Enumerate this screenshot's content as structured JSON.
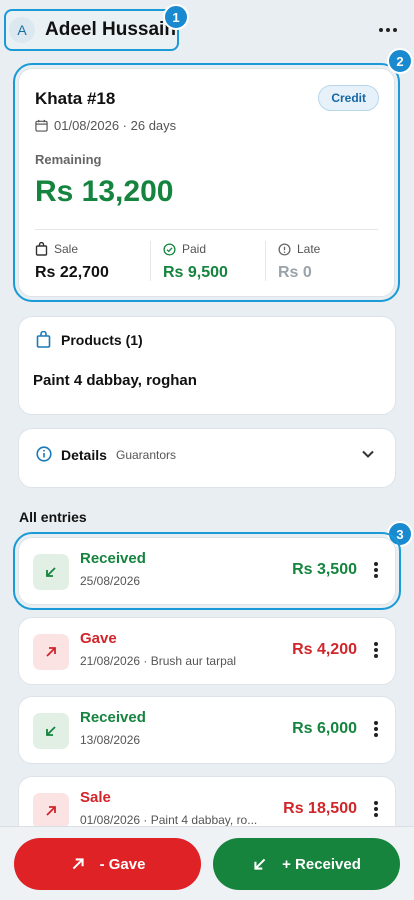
{
  "header": {
    "avatar_initial": "A",
    "user_name": "Adeel Hussain",
    "badge_1": "1"
  },
  "khata": {
    "title": "Khata #18",
    "credit_label": "Credit",
    "date_text": "01/08/2026 · 26 days",
    "remaining_label": "Remaining",
    "remaining_amount": "Rs 13,200",
    "badge_2": "2",
    "stats": [
      {
        "label": "Sale",
        "value": "Rs 22,700"
      },
      {
        "label": "Paid",
        "value": "Rs 9,500"
      },
      {
        "label": "Late",
        "value": "Rs 0"
      }
    ]
  },
  "products": {
    "title": "Products (1)",
    "text": "Paint 4 dabbay, roghan"
  },
  "details": {
    "title": "Details",
    "subtitle": "Guarantors"
  },
  "entries_section": {
    "title": "All entries",
    "badge_3": "3",
    "entries": [
      {
        "title": "Received",
        "sub": "25/08/2026",
        "amount": "Rs 3,500"
      },
      {
        "title": "Gave",
        "sub": "21/08/2026 · Brush aur tarpal",
        "amount": "Rs 4,200"
      },
      {
        "title": "Received",
        "sub": "13/08/2026",
        "amount": "Rs 6,000"
      },
      {
        "title": "Sale",
        "sub": "01/08/2026 · Paint 4 dabbay, ro...",
        "amount": "Rs 18,500"
      }
    ]
  },
  "actions": {
    "gave_label": "- Gave",
    "received_label": "+ Received"
  },
  "colors": {
    "accent": "#1a9ad6",
    "green": "#14843e",
    "red": "#d0262b"
  }
}
